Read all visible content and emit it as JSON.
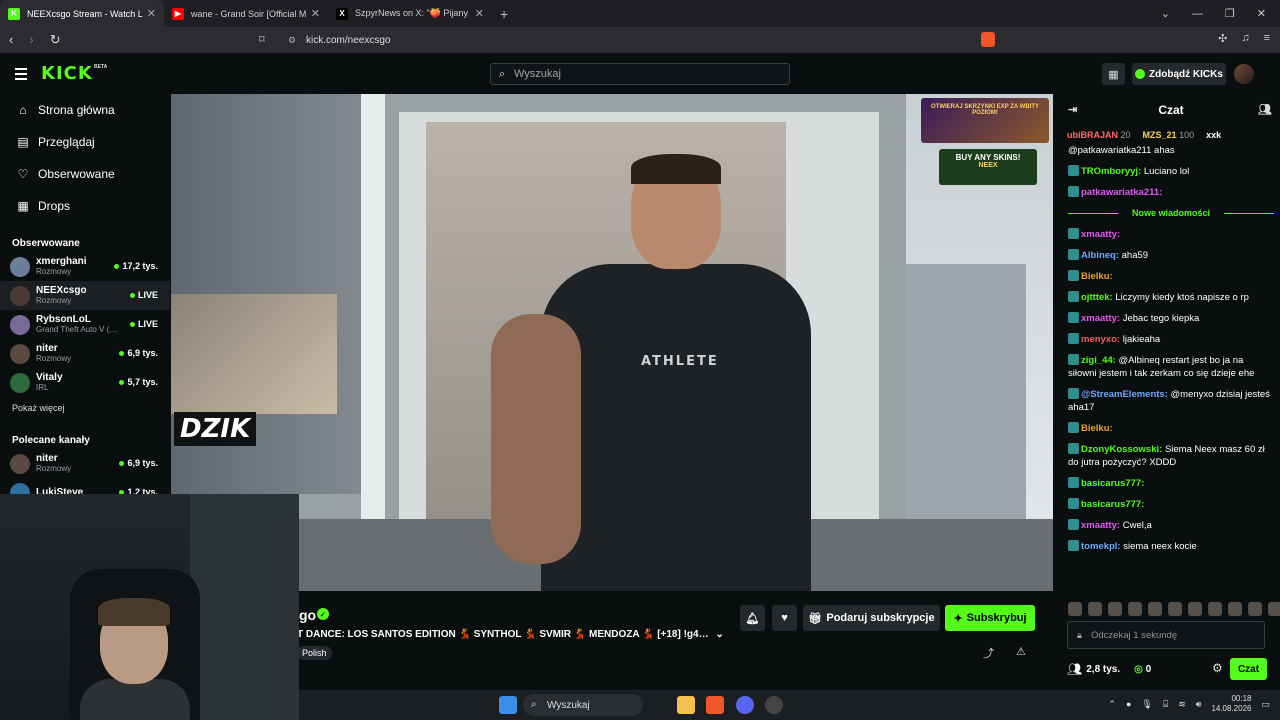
{
  "browser": {
    "tabs": [
      {
        "title": "NEEXcsgo Stream - Watch Li…",
        "icon": "K",
        "color": "#53fc18",
        "active": true
      },
      {
        "title": "wane - Grand Soir [Official Music Vid…",
        "icon": "▶",
        "color": "#ff0000",
        "active": false
      },
      {
        "title": "SzpyrNews on X: \"🍑 Pijany Szeliga c…",
        "icon": "X",
        "color": "#000000",
        "active": false
      }
    ],
    "url": "kick.com/neexcsgo",
    "new_tab": "+"
  },
  "header": {
    "logo": "KICK",
    "beta": "BETA",
    "search_placeholder": "Wyszukaj",
    "kicks_button": "Zdobądź KICKs"
  },
  "sidebar": {
    "nav": [
      {
        "label": "Strona główna",
        "icon": "home-icon",
        "glyph": "⌂"
      },
      {
        "label": "Przeglądaj",
        "icon": "browse-icon",
        "glyph": "▤"
      },
      {
        "label": "Obserwowane",
        "icon": "heart-icon",
        "glyph": "♡"
      },
      {
        "label": "Drops",
        "icon": "drops-icon",
        "glyph": "▦"
      }
    ],
    "followed_title": "Obserwowane",
    "followed": [
      {
        "name": "xmerghani",
        "sub": "Rozmowy",
        "count": "17,2 tys.",
        "live": false,
        "color": "#6a7f99"
      },
      {
        "name": "NEEXcsgo",
        "sub": "Rozmowy",
        "count": "LIVE",
        "live": true,
        "color": "#4b3a33"
      },
      {
        "name": "RybsonLoL",
        "sub": "Grand Theft Auto V (…",
        "count": "LIVE",
        "live": true,
        "color": "#7a6a9a"
      },
      {
        "name": "niter",
        "sub": "Rozmowy",
        "count": "6,9 tys.",
        "live": false,
        "color": "#5a4a40"
      },
      {
        "name": "Vitaly",
        "sub": "IRL",
        "count": "5,7 tys.",
        "live": false,
        "color": "#2e6b3a"
      }
    ],
    "show_more": "Pokaż więcej",
    "recommended_title": "Polecane kanały",
    "recommended": [
      {
        "name": "niter",
        "sub": "Rozmowy",
        "count": "6,9 tys.",
        "color": "#5a4a40"
      },
      {
        "name": "LukiSteve",
        "sub": "",
        "count": "1,2 tys.",
        "color": "#2c6fa0"
      }
    ]
  },
  "stream": {
    "name_fragment": "go",
    "title": "T DANCE: LOS SANTOS EDITION 💃 SYNTHOL 💃 SVMIR 💃 MENDOZA 💃 [+18] !g4…",
    "language": "Polish",
    "overlay_brand": "DZIK",
    "promo_text": "OTWIERAJ SKRZYNKI EXP ZA WBITY POZIOM!",
    "promo2_text": "BUY ANY SKINS!",
    "promo2_brand": "NEEX",
    "gift_sub_label": "Podaruj subskrypcje",
    "subscribe_label": "Subskrybuj",
    "shirt_logo": "ATHLETE"
  },
  "chat": {
    "title": "Czat",
    "leaderboard": [
      {
        "name": "ubiBRAJAN",
        "value": "20",
        "color": "#ff6b6b"
      },
      {
        "name": "MZS_21",
        "value": "100",
        "color": "#ffd35a"
      },
      {
        "name": "xxk",
        "value": "",
        "color": "#ffffff"
      }
    ],
    "top_partial": "@patkawariatka211 ahas",
    "messages_before": [
      {
        "user": "TROmboryyj:",
        "text": "Luciano lol",
        "color": "#53fc18"
      },
      {
        "user": "patkawariatka211:",
        "text": "",
        "color": "#e05af0"
      }
    ],
    "new_messages_label": "Nowe wiadomości",
    "messages": [
      {
        "user": "xmaatty:",
        "text": "",
        "color": "#e05af0"
      },
      {
        "user": "Albineq:",
        "text": "aha59",
        "color": "#6fa8ff"
      },
      {
        "user": "Bielku:",
        "text": "",
        "color": "#f0a030"
      },
      {
        "user": "ojtttek:",
        "text": "Liczymy kiedy ktoś napisze o rp",
        "color": "#53fc18"
      },
      {
        "user": "xmaatty:",
        "text": "Jebac tego kiepka",
        "color": "#e05af0"
      },
      {
        "user": "menyxo:",
        "text": "ljakieaha",
        "color": "#f06060"
      },
      {
        "user": "zigi_44:",
        "text": "@Albineq restart jest bo ja na siłowni jestem i tak zerkam co się dzieje ehe",
        "color": "#53fc18"
      },
      {
        "user": "@StreamElements:",
        "text": "@menyxo dzisiaj jesteś aha17",
        "color": "#6fa8ff"
      },
      {
        "user": "Bielku:",
        "text": "",
        "color": "#f0a030"
      },
      {
        "user": "DzonyKossowski:",
        "text": "Siema Neex masz 60 zł do jutra pożyczyć? XDDD",
        "color": "#53fc18"
      },
      {
        "user": "basicarus777:",
        "text": "",
        "color": "#53fc18"
      },
      {
        "user": "basicarus777:",
        "text": "",
        "color": "#53fc18"
      },
      {
        "user": "xmaatty:",
        "text": "Cwel,a",
        "color": "#e05af0"
      },
      {
        "user": "tomekpl:",
        "text": "siema neex kocie",
        "color": "#6fa8ff"
      }
    ],
    "input_placeholder": "Odczekaj 1 sekundę",
    "viewers": "2,8 tys.",
    "points": "0",
    "send_label": "Czat"
  },
  "taskbar": {
    "search": "Wyszukaj",
    "time": "00:18",
    "date": "14.08.2026"
  }
}
